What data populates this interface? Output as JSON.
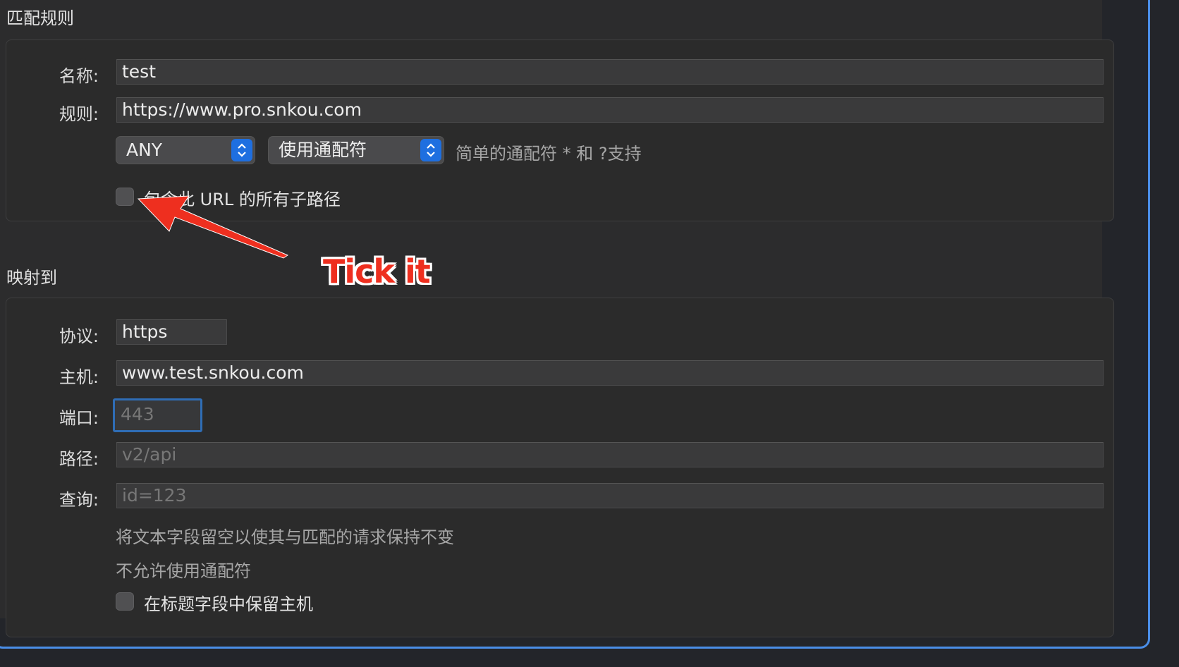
{
  "match_section": {
    "title": "匹配规则",
    "name_label": "名称:",
    "name_value": "test",
    "rule_label": "规则:",
    "rule_value": "https://www.pro.snkou.com",
    "method_select": "ANY",
    "wildcard_select": "使用通配符",
    "wildcard_hint": "简单的通配符 * 和 ?支持",
    "subpath_checkbox_label": "包含此 URL 的所有子路径",
    "subpath_checked": false
  },
  "map_section": {
    "title": "映射到",
    "protocol_label": "协议:",
    "protocol_value": "https",
    "host_label": "主机:",
    "host_value": "www.test.snkou.com",
    "port_label": "端口:",
    "port_placeholder": "443",
    "path_label": "路径:",
    "path_placeholder": "v2/api",
    "query_label": "查询:",
    "query_placeholder": "id=123",
    "note_line1": "将文本字段留空以使其与匹配的请求保持不变",
    "note_line2": "不允许使用通配符",
    "preserve_host_label": "在标题字段中保留主机",
    "preserve_host_checked": false
  },
  "annotation": {
    "text": "Tick it",
    "color": "#ee2f1f"
  },
  "colors": {
    "accent": "#1e6fe0",
    "focus_ring": "#2f6db5",
    "window_border": "#4a8ee8"
  }
}
